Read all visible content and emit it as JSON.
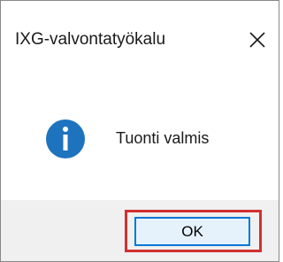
{
  "window": {
    "title": "IXG-valvontatyökalu",
    "close_icon": "close-icon"
  },
  "message": {
    "icon": "info-icon",
    "text": "Tuonti valmis"
  },
  "footer": {
    "ok_label": "OK"
  },
  "colors": {
    "info_icon": "#1e73be",
    "button_border": "#0078d7",
    "button_fill": "#e5f1fb",
    "highlight_border": "#d32f2f",
    "footer_bg": "#f0f0f0"
  }
}
